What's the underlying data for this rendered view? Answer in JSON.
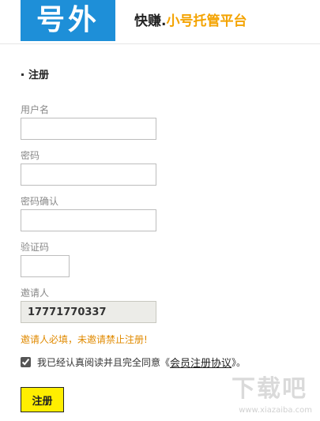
{
  "header": {
    "logo_text": "号外",
    "slogan_prefix": "快赚.",
    "slogan_highlight": "小号托管平台"
  },
  "form": {
    "title": "注册",
    "username_label": "用户名",
    "username_value": "",
    "password_label": "密码",
    "password_value": "",
    "password_confirm_label": "密码确认",
    "password_confirm_value": "",
    "captcha_label": "验证码",
    "captcha_value": "",
    "inviter_label": "邀请人",
    "inviter_value": "17771770337",
    "warning": "邀请人必填，未邀请禁止注册!",
    "agree_text": "我已经认真阅读并且完全同意《",
    "agree_link": "会员注册协议",
    "agree_suffix": "》。",
    "agree_checked": true,
    "submit_label": "注册"
  },
  "watermark": {
    "main": "下载吧",
    "url": "www.xiazaiba.com"
  },
  "colors": {
    "brand_blue": "#1e8fd8",
    "accent_orange": "#f4a300",
    "warning": "#e08a00",
    "button_yellow": "#ffee00"
  }
}
